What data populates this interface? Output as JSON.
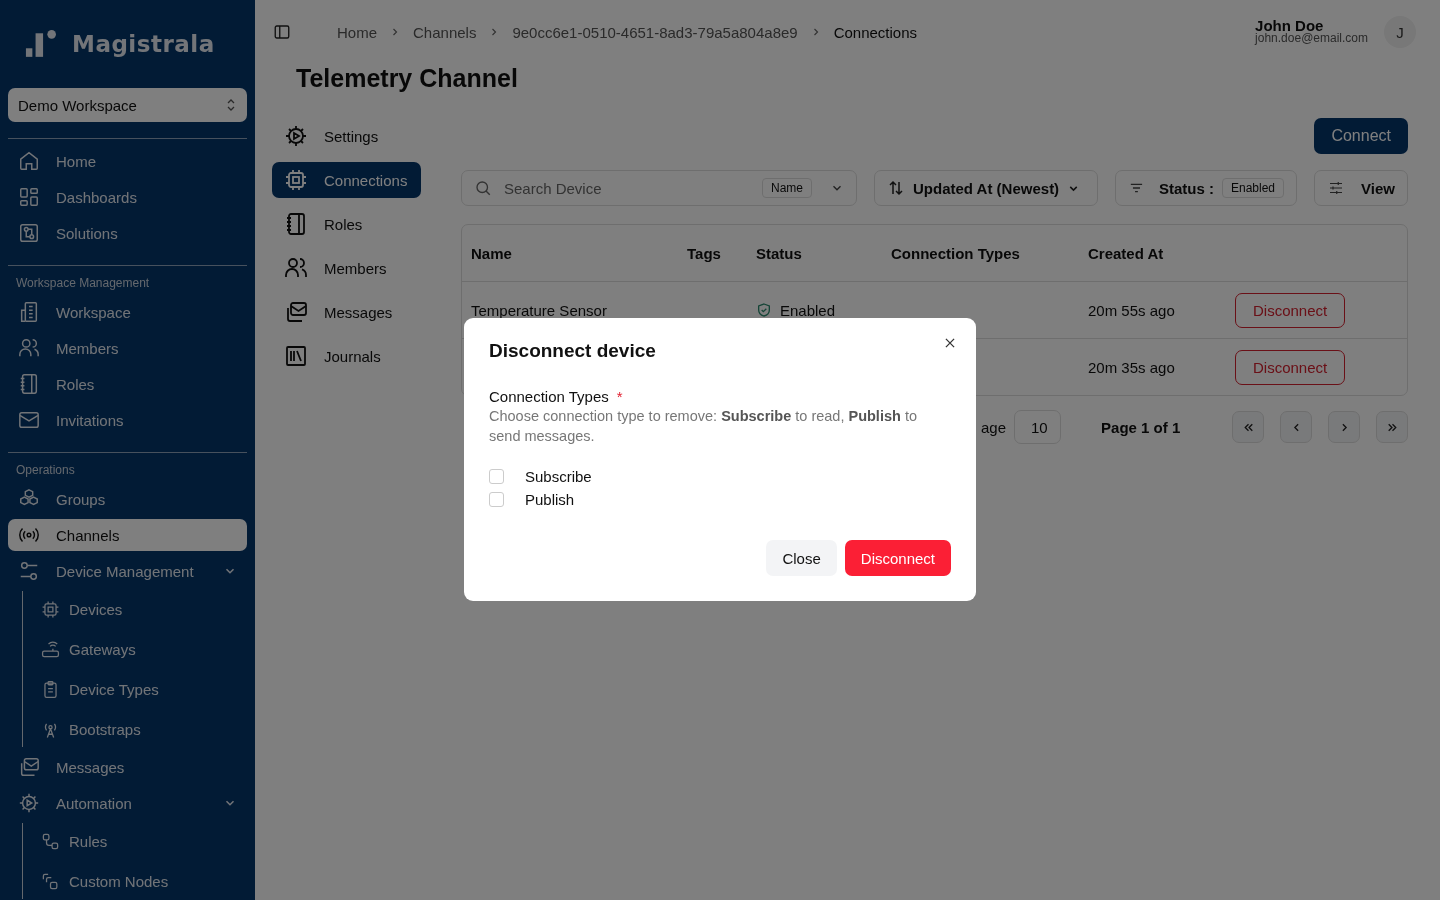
{
  "sidebar": {
    "brand": "Magistrala",
    "workspace": "Demo Workspace",
    "sections": [
      {
        "items": [
          {
            "label": "Home",
            "selected": false
          },
          {
            "label": "Dashboards",
            "selected": false
          },
          {
            "label": "Solutions",
            "selected": false
          }
        ]
      },
      {
        "heading": "Workspace Management",
        "items": [
          {
            "label": "Workspace",
            "selected": false
          },
          {
            "label": "Members",
            "selected": false
          },
          {
            "label": "Roles",
            "selected": false
          },
          {
            "label": "Invitations",
            "selected": false
          }
        ]
      },
      {
        "heading": "Operations",
        "items": [
          {
            "label": "Groups",
            "selected": false
          },
          {
            "label": "Channels",
            "selected": true
          },
          {
            "label": "Device Management",
            "selected": false,
            "expanded": true,
            "children": [
              {
                "label": "Devices",
                "selected": false
              },
              {
                "label": "Gateways",
                "selected": false
              },
              {
                "label": "Device Types",
                "selected": false
              },
              {
                "label": "Bootstraps",
                "selected": false
              }
            ]
          },
          {
            "label": "Messages",
            "selected": false
          },
          {
            "label": "Automation",
            "selected": false,
            "expanded": true,
            "children": [
              {
                "label": "Rules",
                "selected": false
              },
              {
                "label": "Custom Nodes",
                "selected": false
              }
            ]
          }
        ]
      }
    ]
  },
  "breadcrumb": [
    "Home",
    "Channels",
    "9e0cc6e1-0510-4651-8ad3-79a5a804a8e9",
    "Connections"
  ],
  "user": {
    "name": "John Doe",
    "email": "john.doe@email.com",
    "initial": "J"
  },
  "page_title": "Telemetry Channel",
  "channel_nav": [
    {
      "label": "Settings",
      "selected": false
    },
    {
      "label": "Connections",
      "selected": true
    },
    {
      "label": "Roles",
      "selected": false
    },
    {
      "label": "Members",
      "selected": false
    },
    {
      "label": "Messages",
      "selected": false
    },
    {
      "label": "Journals",
      "selected": false
    }
  ],
  "connect_button": "Connect",
  "search": {
    "placeholder": "Search Device",
    "field": "Name"
  },
  "sort": "Updated At (Newest)",
  "status_filter": {
    "label": "Status :",
    "value": "Enabled"
  },
  "view_button": "View",
  "table": {
    "columns": [
      "Name",
      "Tags",
      "Status",
      "Connection Types",
      "Created At"
    ],
    "rows": [
      {
        "name": "Temperature Sensor",
        "status": "Enabled",
        "created": "20m 55s ago",
        "action": "Disconnect"
      },
      {
        "created": "20m 35s ago",
        "action": "Disconnect"
      }
    ]
  },
  "pagination": {
    "rows_label": "age",
    "rows_value": "10",
    "page": "Page 1 of 1"
  },
  "modal": {
    "title": "Disconnect device",
    "field_label": "Connection Types",
    "required_mark": "*",
    "description": "Choose connection type to remove: **Subscribe** to read, **Publish** to send messages.",
    "options": [
      {
        "label": "Subscribe",
        "checked": false
      },
      {
        "label": "Publish",
        "checked": false
      }
    ],
    "buttons": [
      {
        "label": "Close",
        "kind": "secondary"
      },
      {
        "label": "Disconnect",
        "kind": "danger"
      }
    ]
  }
}
